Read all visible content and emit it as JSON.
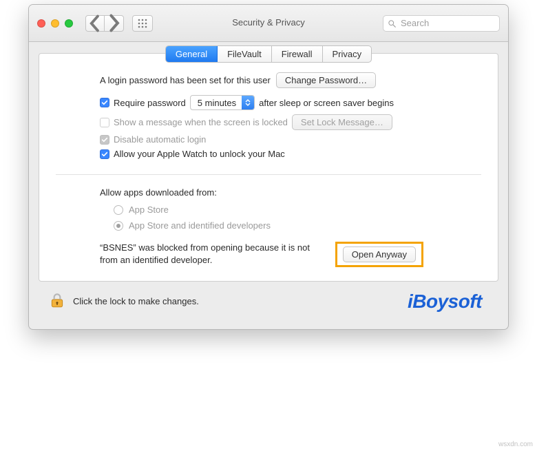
{
  "toolbar": {
    "title": "Security & Privacy",
    "search_placeholder": "Search"
  },
  "tabs": {
    "general": "General",
    "filevault": "FileVault",
    "firewall": "Firewall",
    "privacy": "Privacy"
  },
  "login": {
    "statement": "A login password has been set for this user",
    "change_btn": "Change Password…",
    "require_pw": "Require password",
    "select_value": "5 minutes",
    "after_sleep": "after sleep or screen saver begins",
    "show_msg": "Show a message when the screen is locked",
    "set_lock_btn": "Set Lock Message…",
    "disable_auto": "Disable automatic login",
    "apple_watch": "Allow your Apple Watch to unlock your Mac"
  },
  "download": {
    "heading": "Allow apps downloaded from:",
    "opt_appstore": "App Store",
    "opt_identified": "App Store and identified developers",
    "blocked_msg": "“BSNES” was blocked from opening because it is not from an identified developer.",
    "open_anyway": "Open Anyway"
  },
  "footer": {
    "lock_msg": "Click the lock to make changes."
  },
  "brand": "iBoysoft",
  "watermark": "wsxdn.com"
}
